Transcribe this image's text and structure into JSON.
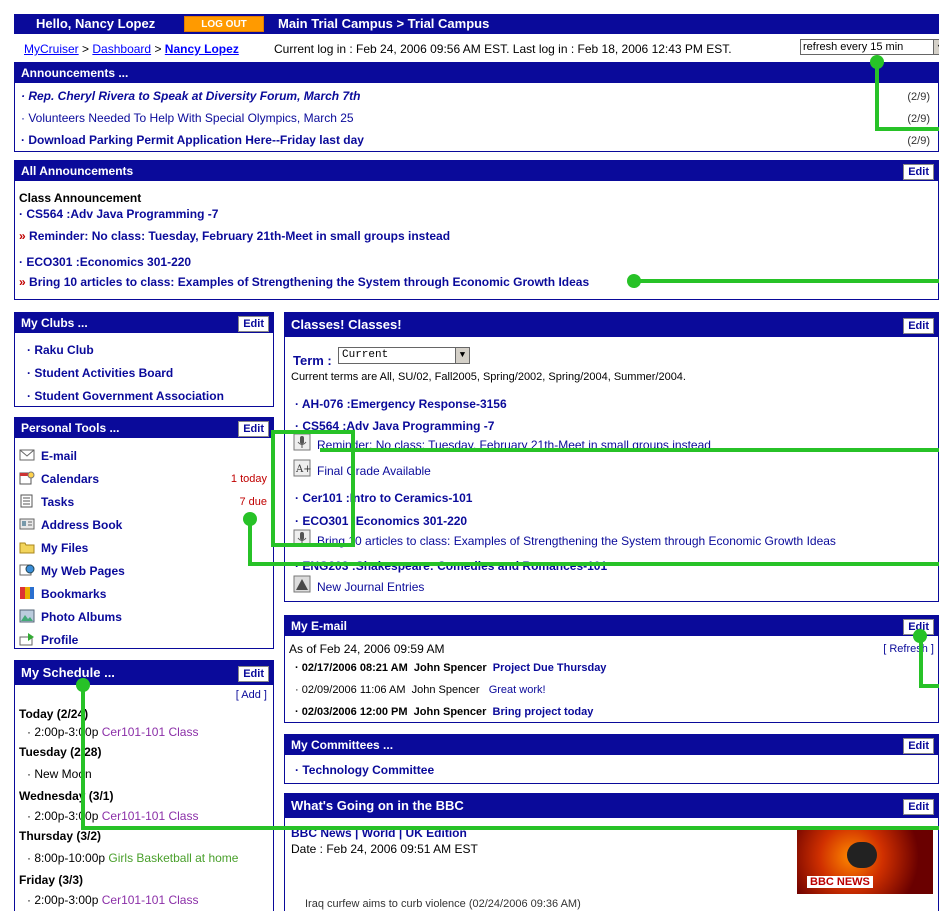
{
  "topbar": {
    "hello": "Hello, Nancy Lopez",
    "logout": "LOG OUT",
    "campus": "Main Trial Campus > Trial Campus"
  },
  "breadcrumb": {
    "mycruiser": "MyCruiser",
    "dashboard": "Dashboard",
    "current": "Nancy Lopez",
    "sep": ">"
  },
  "login_info": "Current log in : Feb 24, 2006 09:56 AM EST. Last log in : Feb 18, 2006 12:43 PM EST.",
  "refresh": {
    "value": "refresh every 15 min"
  },
  "announcements": {
    "title": "Announcements ...",
    "items": [
      {
        "text": "Rep. Cheryl Rivera to Speak at Diversity Forum, March 7th",
        "count": "(2/9)"
      },
      {
        "text": "Volunteers Needed To Help With Special Olympics, March 25",
        "count": "(2/9)"
      },
      {
        "text": "Download Parking Permit Application Here--Friday last day",
        "count": "(2/9)"
      }
    ]
  },
  "all_announcements": {
    "title": "All Announcements",
    "edit": "Edit",
    "heading": "Class Announcement",
    "c1": "CS564 :Adv Java Programming -7",
    "c1_msg": "Reminder: No class: Tuesday, February 21th-Meet in small groups instead",
    "c2": "ECO301 :Economics 301-220",
    "c2_msg": "Bring 10 articles to class: Examples of Strengthening the System through Economic Growth Ideas"
  },
  "clubs": {
    "title": "My Clubs ...",
    "edit": "Edit",
    "items": [
      "Raku Club",
      "Student Activities Board",
      "Student Government Association"
    ]
  },
  "tools": {
    "title": "Personal Tools ...",
    "edit": "Edit",
    "items": [
      {
        "label": "E-mail",
        "icon": "envelope-icon",
        "badge": ""
      },
      {
        "label": "Calendars",
        "icon": "calendar-icon",
        "badge": "1 today"
      },
      {
        "label": "Tasks",
        "icon": "tasks-icon",
        "badge": "7 due"
      },
      {
        "label": "Address Book",
        "icon": "address-book-icon",
        "badge": ""
      },
      {
        "label": "My Files",
        "icon": "folder-icon",
        "badge": ""
      },
      {
        "label": "My Web Pages",
        "icon": "web-pages-icon",
        "badge": ""
      },
      {
        "label": "Bookmarks",
        "icon": "bookmarks-icon",
        "badge": ""
      },
      {
        "label": "Photo Albums",
        "icon": "photo-album-icon",
        "badge": ""
      },
      {
        "label": "Profile",
        "icon": "profile-icon",
        "badge": ""
      }
    ]
  },
  "schedule": {
    "title": "My Schedule ...",
    "edit": "Edit",
    "add": "[ Add ]",
    "d1": "Today (2/24)",
    "d1_time": "2:00p-3:00p",
    "d1_ev": "Cer101-101 Class",
    "d2": "Tuesday (2/28)",
    "d2_ev": "New Moon",
    "d3": "Wednesday (3/1)",
    "d3_time": "2:00p-3:00p",
    "d3_ev": "Cer101-101 Class",
    "d4": "Thursday (3/2)",
    "d4_time": "8:00p-10:00p",
    "d4_ev": "Girls Basketball at home",
    "d5": "Friday (3/3)",
    "d5_time": "2:00p-3:00p",
    "d5_ev": "Cer101-101 Class"
  },
  "classes": {
    "title": "Classes! Classes!",
    "edit": "Edit",
    "term_label": "Term :",
    "term_value": "Current",
    "terms_note": "Current terms are All, SU/02, Fall2005, Spring/2002, Spring/2004, Summer/2004.",
    "c1": "AH-076 :Emergency Response-3156",
    "c2": "CS564 :Adv Java Programming -7",
    "c2_msg": "Reminder: No class: Tuesday, February 21th-Meet in small groups instead",
    "c2_grade": "Final Grade Available",
    "c3": "Cer101 :Intro to Ceramics-101",
    "c4": "ECO301 :Economics 301-220",
    "c4_msg": "Bring 10 articles to class: Examples of Strengthening the System through Economic Growth Ideas",
    "c5": "ENG203 :Shakespeare: Comedies and Romances-101",
    "c5_journal": "New Journal Entries"
  },
  "email": {
    "title": "My E-mail",
    "edit": "Edit",
    "asof": "As of Feb 24, 2006 09:59 AM",
    "refresh": "[ Refresh ]",
    "rows": [
      {
        "date": "02/17/2006 08:21 AM",
        "from": "John Spencer",
        "subject": "Project Due Thursday",
        "unread": true
      },
      {
        "date": "02/09/2006 11:06 AM",
        "from": "John Spencer",
        "subject": "Great work!",
        "unread": false
      },
      {
        "date": "02/03/2006 12:00 PM",
        "from": "John Spencer",
        "subject": "Bring project today",
        "unread": true
      }
    ]
  },
  "committees": {
    "title": "My Committees ...",
    "edit": "Edit",
    "items": [
      "Technology Committee"
    ]
  },
  "bbc": {
    "title": "What's Going on in the BBC",
    "edit": "Edit",
    "feed_title": "BBC News | World | UK Edition",
    "date": "Date : Feb 24, 2006 09:51 AM EST",
    "logo": "BBC NEWS",
    "item": "Iraq curfew aims to curb violence (02/24/2006 09:36 AM)"
  },
  "colors": {
    "header": "#0a0a9a",
    "logout": "#ff9a00",
    "annotation": "#27c227"
  }
}
